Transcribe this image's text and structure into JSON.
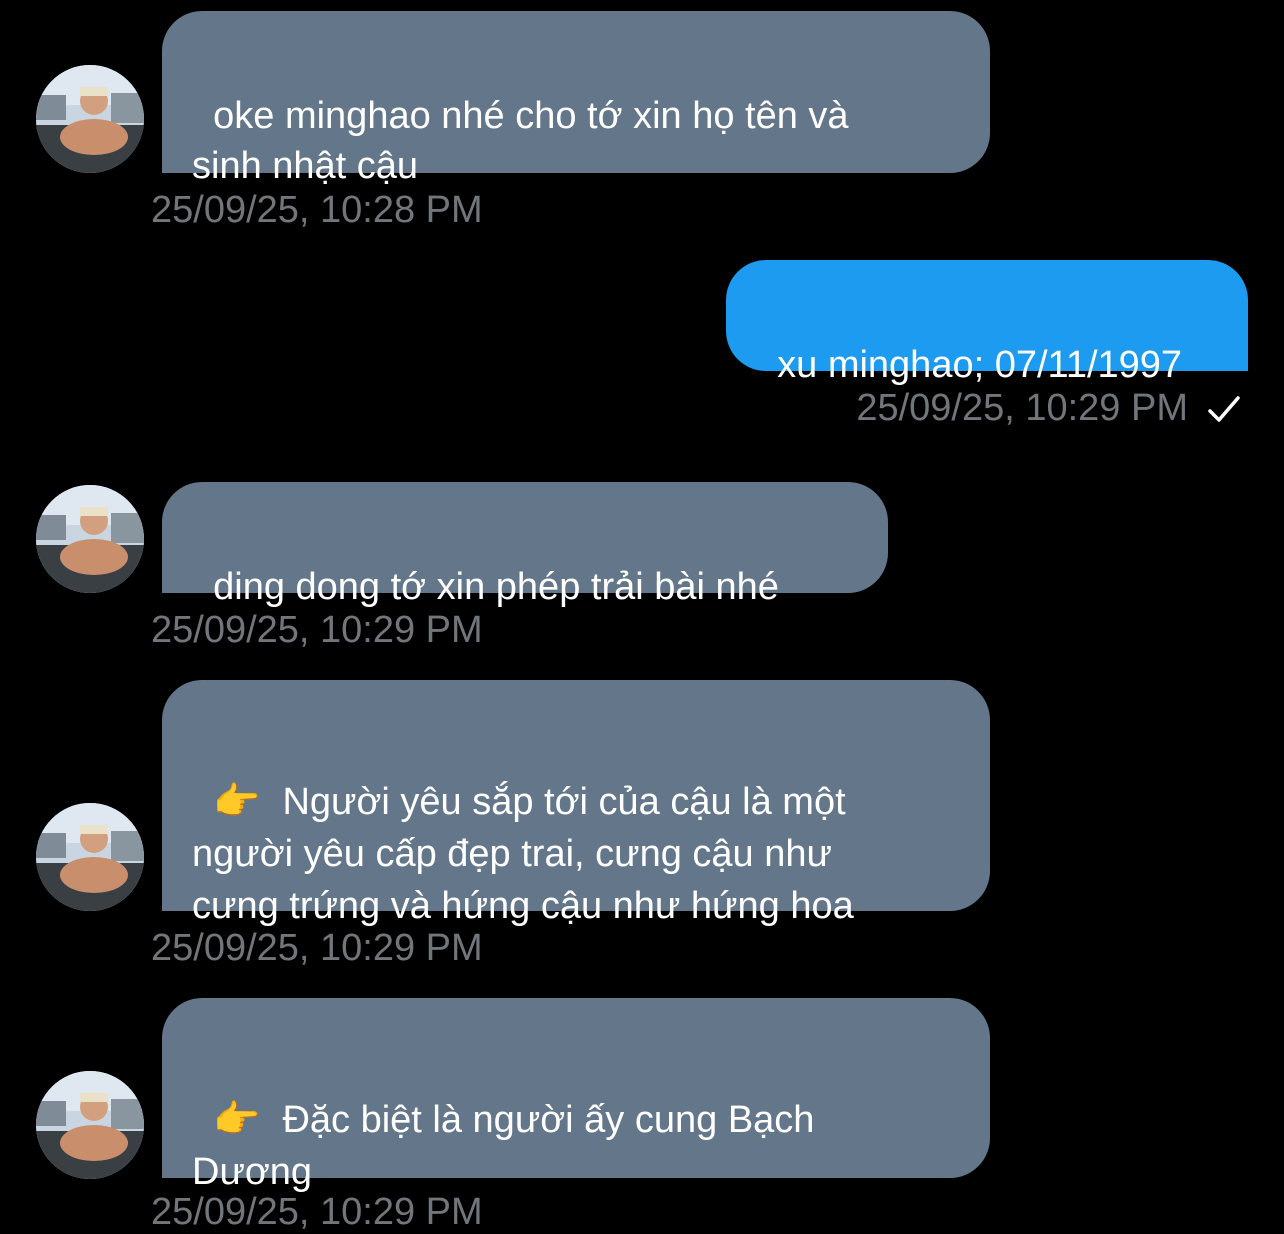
{
  "messages": [
    {
      "direction": "incoming",
      "text": "oke minghao nhé cho tớ xin họ tên và\nsinh nhật cậu",
      "timestamp": "25/09/25, 10:28 PM"
    },
    {
      "direction": "outgoing",
      "text": "xu minghao; 07/11/1997",
      "timestamp": "25/09/25, 10:29 PM",
      "status_icon": "checkmark-icon"
    },
    {
      "direction": "incoming",
      "text": "ding dong tớ xin phép trải bài nhé",
      "timestamp": "25/09/25, 10:29 PM"
    },
    {
      "direction": "incoming",
      "emoji": "👉",
      "text": "Người yêu sắp tới của cậu là một\nngười yêu cấp đẹp trai, cưng cậu như\ncưng trứng và hứng cậu như hứng hoa",
      "timestamp": "25/09/25, 10:29 PM"
    },
    {
      "direction": "incoming",
      "emoji": "👉",
      "text": "Đặc biệt là người ấy cung Bạch\nDương",
      "timestamp": "25/09/25, 10:29 PM"
    }
  ],
  "colors": {
    "background": "#000000",
    "incoming_bubble": "#64778a",
    "outgoing_bubble": "#1d9bf0",
    "timestamp": "#71767b",
    "text": "#ffffff"
  }
}
